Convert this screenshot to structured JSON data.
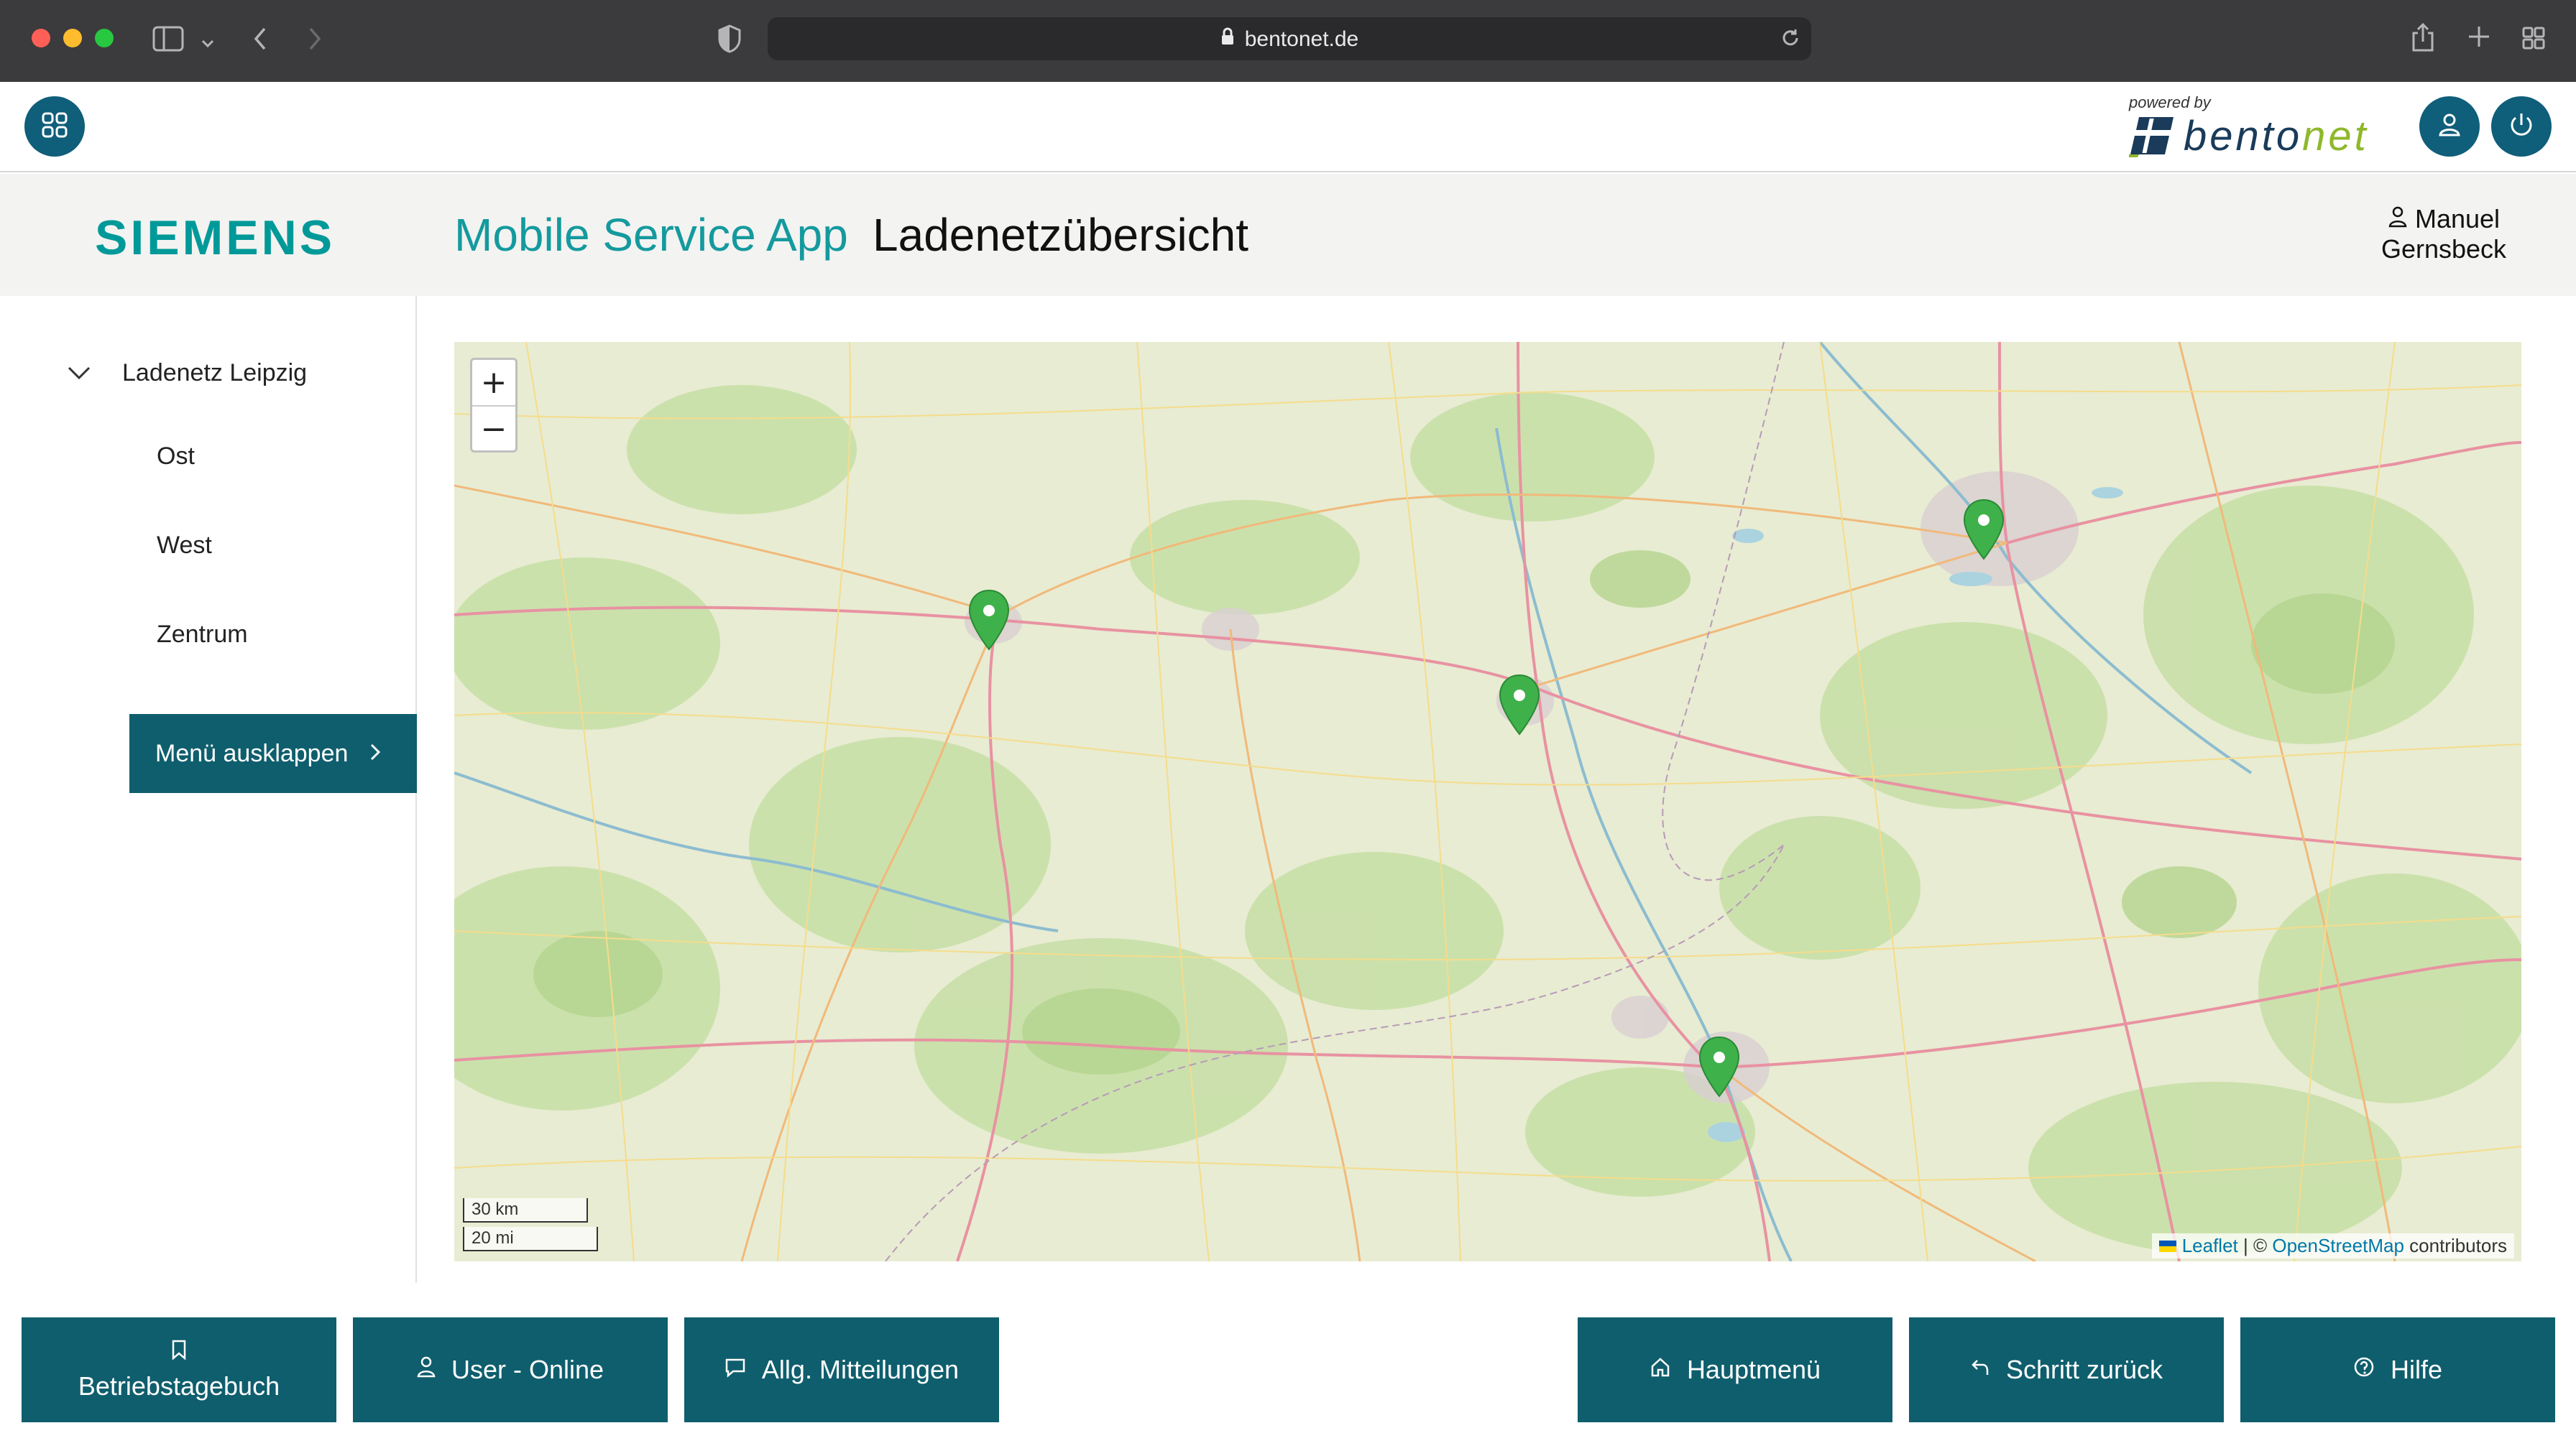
{
  "browser": {
    "url": "bentonet.de",
    "traffic_colors": [
      "#ff5f57",
      "#febc2e",
      "#28c840"
    ]
  },
  "appbar": {
    "powered_by": "powered by",
    "logo_text_a": "bento",
    "logo_text_b": "net"
  },
  "header": {
    "brand": "SIEMENS",
    "app_title": "Mobile Service App",
    "page_title": "Ladenetzübersicht",
    "user_first": "Manuel",
    "user_last": "Gernsbeck"
  },
  "sidebar": {
    "root": "Ladenetz Leipzig",
    "children": [
      "Ost",
      "West",
      "Zentrum"
    ],
    "menu_button": "Menü ausklappen"
  },
  "map": {
    "zoom_in": "+",
    "zoom_out": "−",
    "scale_km": "30 km",
    "scale_mi": "20 mi",
    "attr_leaflet": "Leaflet",
    "attr_sep": " | © ",
    "attr_osm": "OpenStreetMap",
    "attr_contrib": " contributors",
    "marker_color": "#3fb14a"
  },
  "footer": {
    "logbook": "Betriebstagebuch",
    "user_online": "User - Online",
    "messages": "Allg. Mitteilungen",
    "main_menu": "Hauptmenü",
    "step_back": "Schritt zurück",
    "help": "Hilfe"
  },
  "colors": {
    "brand_teal": "#009999",
    "button_teal": "#0f5e6d",
    "round_blue": "#0f5e7a"
  }
}
